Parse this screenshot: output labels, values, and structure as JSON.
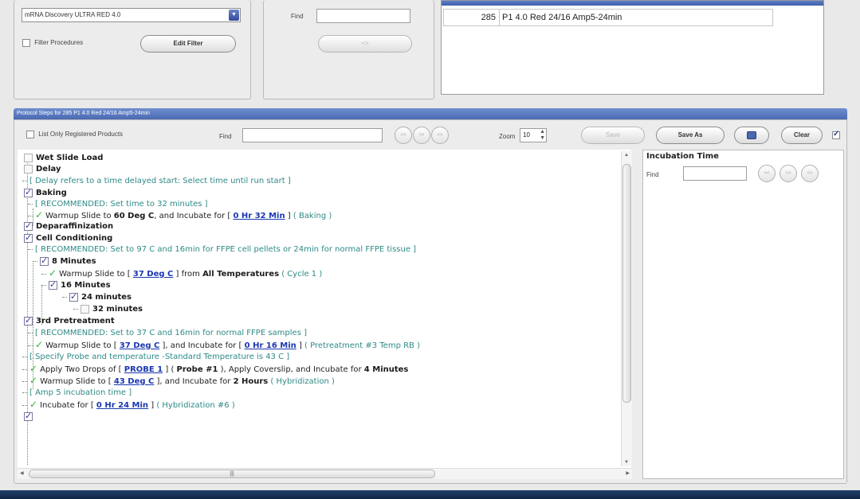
{
  "procedure_panel": {
    "selected_procedure": "mRNA Discovery ULTRA RED 4.0",
    "filter_label": "Filter Procedures",
    "edit_filter_label": "Edit Filter"
  },
  "find_panel": {
    "find_label": "Find",
    "find_value": "",
    "go_label": "<>"
  },
  "protocol_list": {
    "rows": [
      {
        "number": "285",
        "name": "P1 4.0 Red 24/16 Amp5-24min"
      }
    ]
  },
  "steps": {
    "header": "Protocol Steps for 285 P1 4.0 Red 24/16 Amp5-24min",
    "list_only_label": "List Only Registered Products",
    "find_label": "Find",
    "find_value": "",
    "zoom_label": "Zoom",
    "zoom_value": "10",
    "save_label": "Save",
    "save_as_label": "Save As",
    "clear_label": "Clear",
    "arrow_left": "<<",
    "arrow_right": ">>",
    "arrow_both": "<>"
  },
  "tree": {
    "wet_slide_load": "Wet Slide Load",
    "delay": "Delay",
    "delay_note": "[ Delay refers to a time delayed start: Select time until run start ]",
    "baking": "Baking",
    "baking_note": "[ RECOMMENDED: Set time to 32 minutes ]",
    "baking_step_a": "Warmup Slide to ",
    "baking_step_b": "60 Deg C",
    "baking_step_c": ", and Incubate for [ ",
    "baking_step_d": "0 Hr 32 Min",
    "baking_step_e": " ] ",
    "baking_step_f": "( Baking )",
    "deparaffinization": "Deparaffinization",
    "cell_conditioning": "Cell Conditioning",
    "cc_note": "[ RECOMMENDED: Set to 97 C and 16min for FFPE cell pellets or 24min for normal FFPE tissue ]",
    "eight_minutes": "8 Minutes",
    "cc_step_a": "Warmup Slide to [ ",
    "cc_step_b": "37 Deg C",
    "cc_step_c": " ] from ",
    "cc_step_d": "All Temperatures",
    "cc_step_e": " ( Cycle 1 )",
    "sixteen_minutes": "16 Minutes",
    "twentyfour_minutes": "24 minutes",
    "thirtytwo_minutes": "32 minutes",
    "pretreatment": "3rd Pretreatment",
    "pre_note": "[ RECOMMENDED: Set to 37 C and 16min for normal FFPE samples ]",
    "pre_step_a": "Warmup Slide to [ ",
    "pre_step_b": "37 Deg C",
    "pre_step_c": " ], and Incubate for [ ",
    "pre_step_d": "0 Hr 16 Min",
    "pre_step_e": " ] ",
    "pre_step_f": "( Pretreatment #3 Temp RB )",
    "probe_note": "[ Specify Probe and temperature -Standard Temperature is 43 C ]",
    "probe_step_a": "Apply Two Drops of [ ",
    "probe_step_b": "PROBE 1",
    "probe_step_c": " ] ( ",
    "probe_step_d": "Probe #1",
    "probe_step_e": " ), Apply Coverslip, and Incubate for ",
    "probe_step_f": "4 Minutes",
    "hyb_step_a": "Warmup Slide to [ ",
    "hyb_step_b": "43 Deg C",
    "hyb_step_c": " ], and Incubate for ",
    "hyb_step_d": "2 Hours",
    "hyb_step_e": " ( Hybridization )",
    "amp_note": "[ Amp 5 incubation time ]",
    "amp_step_a": "Incubate for [ ",
    "amp_step_b": "0 Hr 24 Min",
    "amp_step_c": " ] ",
    "amp_step_d": "( Hybridization #6 )"
  },
  "incubation": {
    "title": "Incubation Time",
    "find_label": "Find",
    "find_value": ""
  },
  "colors": {
    "header_blue": "#5875bd",
    "note_teal": "#2d8a86",
    "link_blue": "#1a37b0",
    "check_green": "#38b23a"
  }
}
